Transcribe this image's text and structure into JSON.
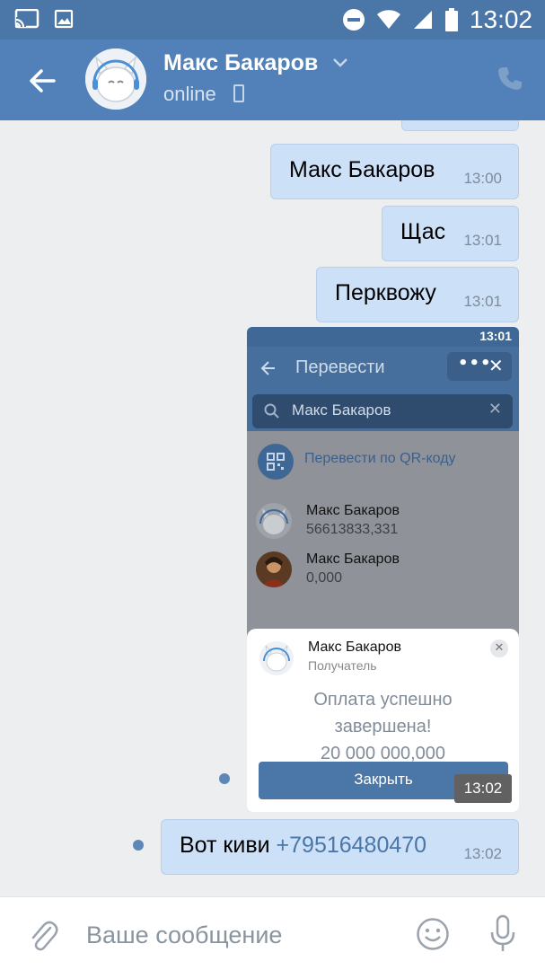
{
  "status_bar": {
    "time": "13:02"
  },
  "header": {
    "name": "Макс Бакаров",
    "status": "online"
  },
  "messages": [
    {
      "text": "Макс Бакаров",
      "time": "13:00"
    },
    {
      "text": "Щас",
      "time": "13:01"
    },
    {
      "text": "Перквожу",
      "time": "13:01"
    },
    {
      "text_prefix": "Вот киви ",
      "link": "+79516480470",
      "time": "13:02"
    }
  ],
  "screenshot_message": {
    "time": "13:02",
    "status_time": "13:01",
    "title": "Перевести",
    "search_value": "Макс Бакаров",
    "qr_label": "Перевести по QR-коду",
    "contacts": [
      {
        "name": "Макс Бакаров",
        "balance": "56613833,331"
      },
      {
        "name": "Макс Бакаров",
        "balance": "0,000"
      }
    ],
    "card": {
      "name": "Макс Бакаров",
      "role": "Получатель",
      "line1": "Оплата успешно",
      "line2": "завершена!",
      "amount": "20 000 000,000",
      "button": "Закрыть"
    }
  },
  "composer": {
    "placeholder": "Ваше сообщение"
  },
  "colors": {
    "header": "#5181b8",
    "status_bar": "#4a76a8",
    "bubble": "#cce0f7",
    "background": "#edeef0",
    "link": "#4a76a8"
  }
}
